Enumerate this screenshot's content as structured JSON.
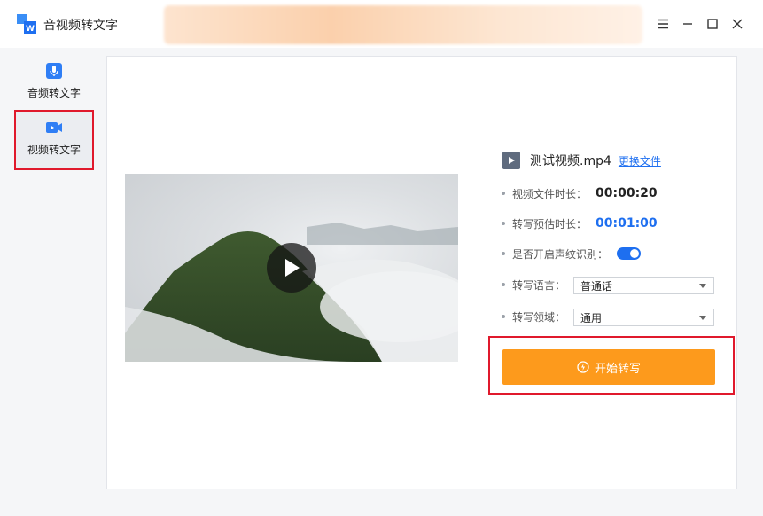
{
  "app": {
    "title": "音视频转文字",
    "accent": "#1e6ff0",
    "highlight": "#e0192c"
  },
  "window_controls": [
    "menu-icon",
    "minimize-icon",
    "maximize-icon",
    "close-icon"
  ],
  "sidebar": {
    "items": [
      {
        "label": "音频转文字",
        "icon": "microphone-icon",
        "active": false
      },
      {
        "label": "视频转文字",
        "icon": "video-camera-icon",
        "active": true
      }
    ]
  },
  "file": {
    "name": "测试视频.mp4",
    "change_label": "更换文件",
    "icon": "video-file-icon"
  },
  "details": {
    "duration_label": "视频文件时长：",
    "duration_value": "00:00:20",
    "estimate_label": "转写预估时长：",
    "estimate_value": "00:01:00",
    "voiceprint_label": "是否开启声纹识别：",
    "voiceprint_on": true,
    "language_label": "转写语言：",
    "language_value": "普通话",
    "domain_label": "转写领域：",
    "domain_value": "通用"
  },
  "start_button": {
    "label": "开始转写",
    "color": "#fd9a1c"
  }
}
